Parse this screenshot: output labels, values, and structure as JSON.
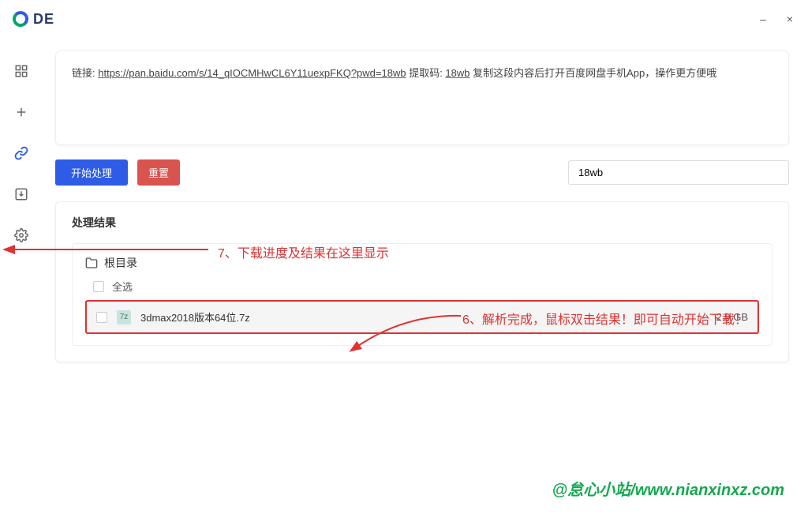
{
  "app": {
    "title": "DE"
  },
  "window": {
    "minimize": "–",
    "close": "×"
  },
  "textarea": {
    "prefix": "链接: ",
    "url": "https://pan.baidu.com/s/14_qIOCMHwCL6Y11uexpFKQ?pwd=18wb",
    "code_prefix": " 提取码: ",
    "code": "18wb",
    "suffix": " 复制这段内容后打开百度网盘手机App，操作更方便哦"
  },
  "actions": {
    "start": "开始处理",
    "reset": "重置",
    "code_value": "18wb"
  },
  "results": {
    "title": "处理结果",
    "root": "根目录",
    "select_all": "全选",
    "file": {
      "name": "3dmax2018版本64位.7z",
      "size": "2.9 GB"
    }
  },
  "annotations": {
    "a7": "7、下载进度及结果在这里显示",
    "a6": "6、解析完成，鼠标双击结果！即可自动开始下载！"
  },
  "watermark": "@怠心小站/www.nianxinxz.com"
}
